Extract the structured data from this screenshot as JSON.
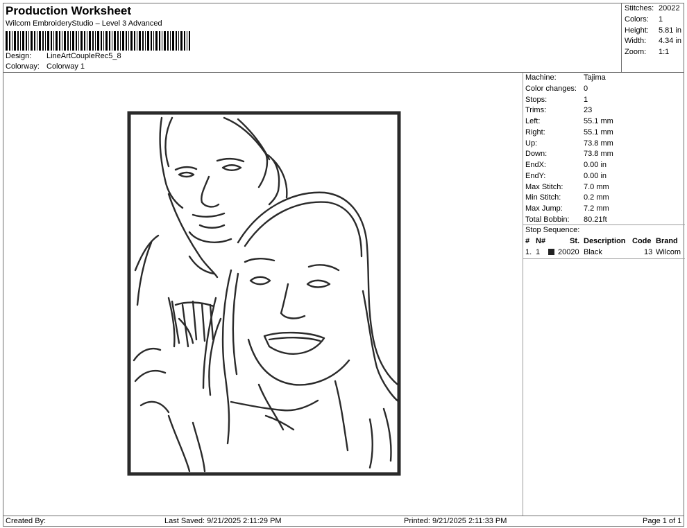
{
  "header": {
    "title": "Production Worksheet",
    "subtitle": "Wilcom EmbroideryStudio – Level 3 Advanced",
    "design_label": "Design:",
    "design_value": "LineArtCoupleRec5_8",
    "colorway_label": "Colorway:",
    "colorway_value": "Colorway 1"
  },
  "stats": {
    "stitches_label": "Stitches:",
    "stitches_value": "20022",
    "colors_label": "Colors:",
    "colors_value": "1",
    "height_label": "Height:",
    "height_value": "5.81 in",
    "width_label": "Width:",
    "width_value": "4.34 in",
    "zoom_label": "Zoom:",
    "zoom_value": "1:1"
  },
  "properties": [
    {
      "label": "Machine:",
      "value": "Tajima"
    },
    {
      "label": "Color changes:",
      "value": "0"
    },
    {
      "label": "Stops:",
      "value": "1"
    },
    {
      "label": "Trims:",
      "value": "23"
    },
    {
      "label": "Left:",
      "value": "55.1 mm"
    },
    {
      "label": "Right:",
      "value": "55.1 mm"
    },
    {
      "label": "Up:",
      "value": "73.8 mm"
    },
    {
      "label": "Down:",
      "value": "73.8 mm"
    },
    {
      "label": "EndX:",
      "value": "0.00 in"
    },
    {
      "label": "EndY:",
      "value": "0.00 in"
    },
    {
      "label": "Max Stitch:",
      "value": "7.0 mm"
    },
    {
      "label": "Min Stitch:",
      "value": "0.2 mm"
    },
    {
      "label": "Max Jump:",
      "value": "7.2 mm"
    },
    {
      "label": "Total Bobbin:",
      "value": "80.21ft"
    }
  ],
  "stop_sequence": {
    "title": "Stop Sequence:",
    "columns": {
      "num": "#",
      "n": "N#",
      "st": "St.",
      "description": "Description",
      "code": "Code",
      "brand": "Brand"
    },
    "rows": [
      {
        "num": "1.",
        "n": "1",
        "swatch_color": "#222222",
        "st": "20020",
        "description": "Black",
        "code": "13",
        "brand": "Wilcom"
      }
    ]
  },
  "footer": {
    "created_by": "Created By:",
    "last_saved": "Last Saved: 9/21/2025 2:11:29 PM",
    "printed": "Printed: 9/21/2025 2:11:33 PM",
    "page": "Page 1 of 1"
  }
}
